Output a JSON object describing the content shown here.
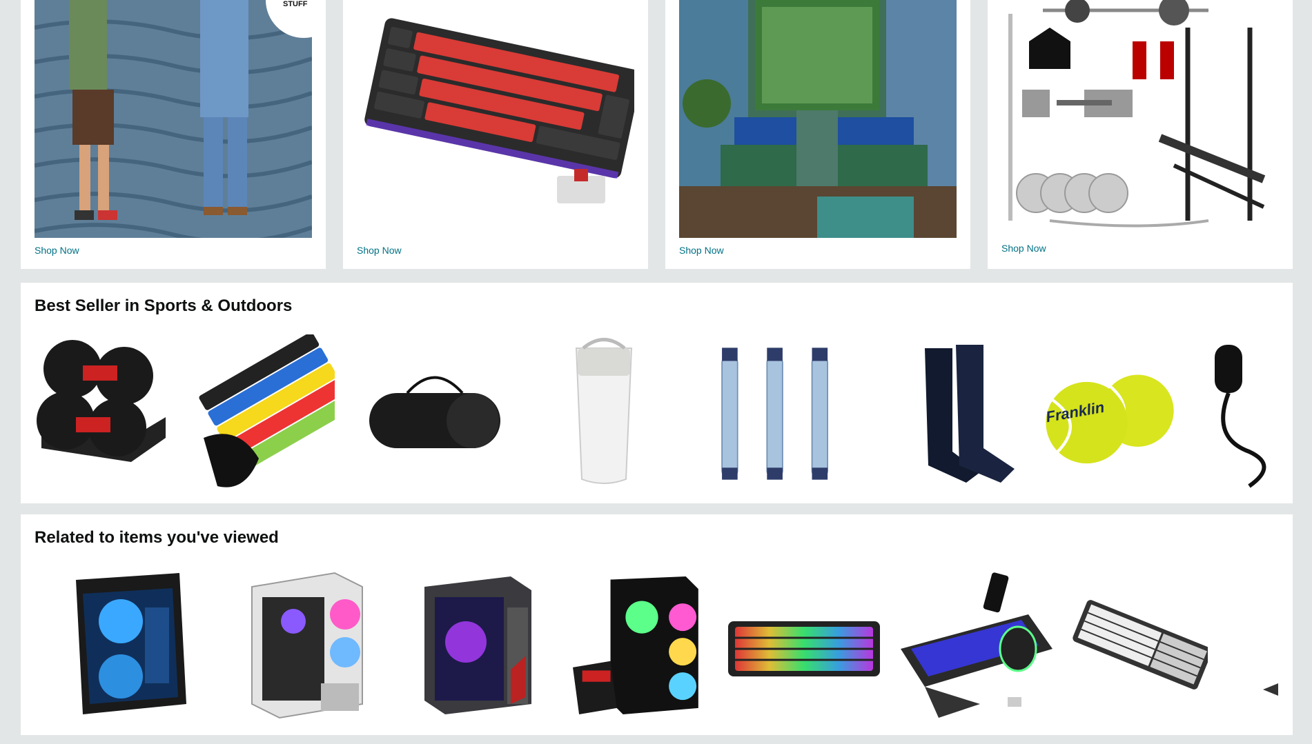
{
  "promos": [
    {
      "link_label": "Shop Now",
      "image_icon": "fashion-photo-icon",
      "badge": "STUFF"
    },
    {
      "link_label": "Shop Now",
      "image_icon": "keyboard-photo-icon"
    },
    {
      "link_label": "Shop Now",
      "image_icon": "room-photo-icon"
    },
    {
      "link_label": "Shop Now",
      "image_icon": "gym-equipment-photo-icon"
    }
  ],
  "best_sellers": {
    "title": "Best Seller in Sports & Outdoors",
    "items": [
      {
        "icon": "dumbbell-product-icon"
      },
      {
        "icon": "resistance-bands-product-icon"
      },
      {
        "icon": "yoga-mat-product-icon"
      },
      {
        "icon": "tumbler-product-icon"
      },
      {
        "icon": "water-filter-product-icon"
      },
      {
        "icon": "socks-product-icon"
      },
      {
        "icon": "tennis-ball-product-icon",
        "print": "Franklin"
      },
      {
        "icon": "jump-rope-product-icon"
      }
    ]
  },
  "related": {
    "title": "Related to items you've viewed",
    "items": [
      {
        "icon": "pc-case-product-icon"
      },
      {
        "icon": "pc-case-product-icon"
      },
      {
        "icon": "pc-case-product-icon"
      },
      {
        "icon": "gaming-pc-product-icon"
      },
      {
        "icon": "rgb-keyboard-product-icon"
      },
      {
        "icon": "keyboard-mouse-combo-product-icon"
      },
      {
        "icon": "white-keyboard-product-icon"
      }
    ]
  },
  "colors": {
    "page_bg": "#e3e6e6",
    "link": "#007185",
    "title": "#0f1111"
  }
}
